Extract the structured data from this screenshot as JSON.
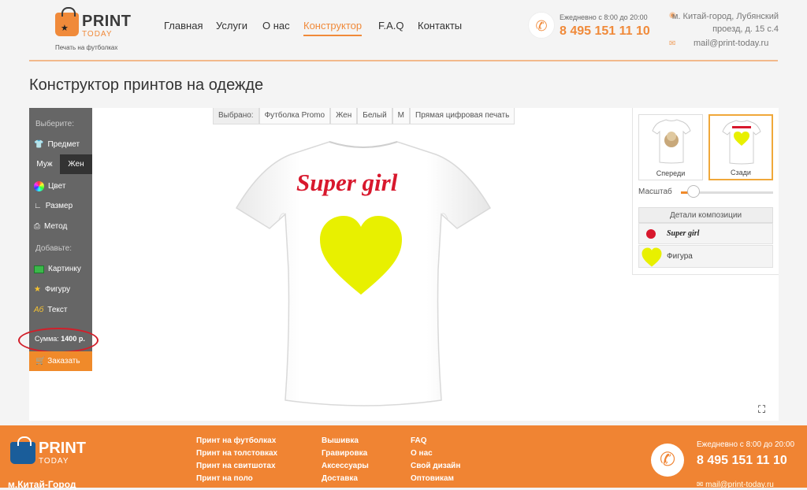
{
  "header": {
    "logo_main": "PRINT",
    "logo_sub": "TODAY",
    "tagline": "Печать на футболках",
    "nav": [
      "Главная",
      "Услуги",
      "О нас",
      "Конструктор",
      "F.A.Q",
      "Контакты"
    ],
    "active_nav": "Конструктор",
    "hours": "Ежедневно с 8:00 до 20:00",
    "phone": "8 495 151 11 10",
    "address": "м. Китай-город, Лубянский проезд, д. 15 с.4",
    "email": "mail@print-today.ru"
  },
  "page": {
    "title": "Конструктор принтов на одежде"
  },
  "sidebar": {
    "choose_label": "Выберите:",
    "item_subject": "Предмет",
    "gender_male": "Муж",
    "gender_female": "Жен",
    "item_color": "Цвет",
    "item_size": "Размер",
    "item_method": "Метод",
    "add_label": "Добавьте:",
    "item_picture": "Картинку",
    "item_shape": "Фигуру",
    "item_text": "Текст",
    "sum_label": "Сумма:",
    "sum_value": "1400 р.",
    "order_label": "Заказать"
  },
  "selection": {
    "label": "Выбрано:",
    "chips": [
      "Футболка Promo",
      "Жен",
      "Белый",
      "M",
      "Прямая цифровая печать"
    ]
  },
  "design": {
    "text": "Super girl",
    "text_color": "#d8182d",
    "shape_color": "#e8f000"
  },
  "panel": {
    "view_front": "Спереди",
    "view_back": "Сзади",
    "zoom_label": "Масштаб",
    "details_title": "Детали композиции",
    "detail_text": "Super girl",
    "detail_shape": "Фигура"
  },
  "footer": {
    "logo_main": "PRINT",
    "logo_sub": "TODAY",
    "city": "м.Китай-Город",
    "col1": [
      "Принт на футболках",
      "Принт на толстовках",
      "Принт на свитшотах",
      "Принт на поло"
    ],
    "col2": [
      "Вышивка",
      "Гравировка",
      "Аксессуары",
      "Доставка"
    ],
    "col3": [
      "FAQ",
      "О нас",
      "Свой дизайн",
      "Оптовикам"
    ],
    "hours": "Ежедневно с 8:00 до 20:00",
    "phone": "8 495 151 11 10",
    "email": "mail@print-today.ru"
  },
  "colors": {
    "accent": "#f08a2a",
    "sidebar": "#666666",
    "footer": "#f08433"
  }
}
